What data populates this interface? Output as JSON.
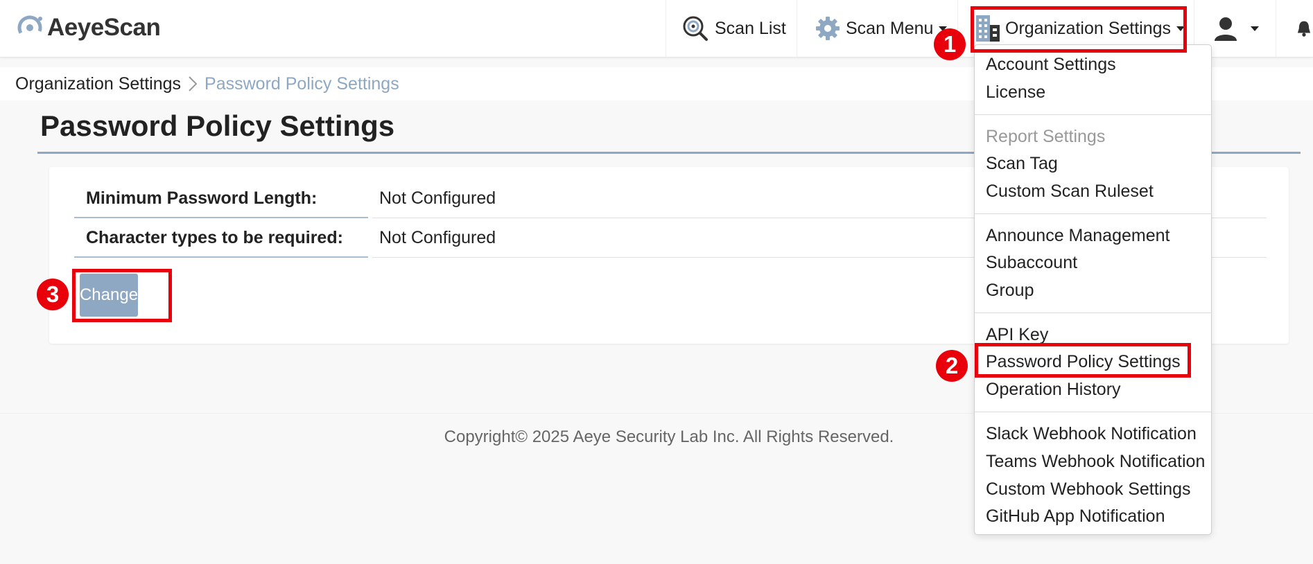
{
  "app": {
    "logo_text": "AeyeScan"
  },
  "nav": {
    "scan_list": "Scan List",
    "scan_menu": "Scan Menu",
    "org_settings": "Organization Settings"
  },
  "breadcrumb": {
    "parent": "Organization Settings",
    "current": "Password Policy Settings"
  },
  "page": {
    "title": "Password Policy Settings",
    "rows": [
      {
        "label": "Minimum Password Length:",
        "value": "Not Configured"
      },
      {
        "label": "Character types to be required:",
        "value": "Not Configured"
      }
    ],
    "change_label": "Change"
  },
  "footer": {
    "copyright": "Copyright© 2025 Aeye Security Lab Inc. All Rights Reserved."
  },
  "dropdown": {
    "group1": [
      "Account Settings",
      "License"
    ],
    "report_header": "Report Settings",
    "group2": [
      "Scan Tag",
      "Custom Scan Ruleset"
    ],
    "group3": [
      "Announce Management",
      "Subaccount",
      "Group"
    ],
    "group4": [
      "API Key",
      "Password Policy Settings",
      "Operation History"
    ],
    "group5": [
      "Slack Webhook Notification",
      "Teams Webhook Notification",
      "Custom Webhook Settings",
      "GitHub App Notification"
    ]
  },
  "annotations": {
    "step1": "1",
    "step2": "2",
    "step3": "3"
  },
  "colors": {
    "accent": "#8ea7c2",
    "highlight": "#e8000b"
  },
  "icons": [
    "scan-list-icon",
    "gear-icon",
    "building-icon",
    "user-icon",
    "bell-icon"
  ]
}
